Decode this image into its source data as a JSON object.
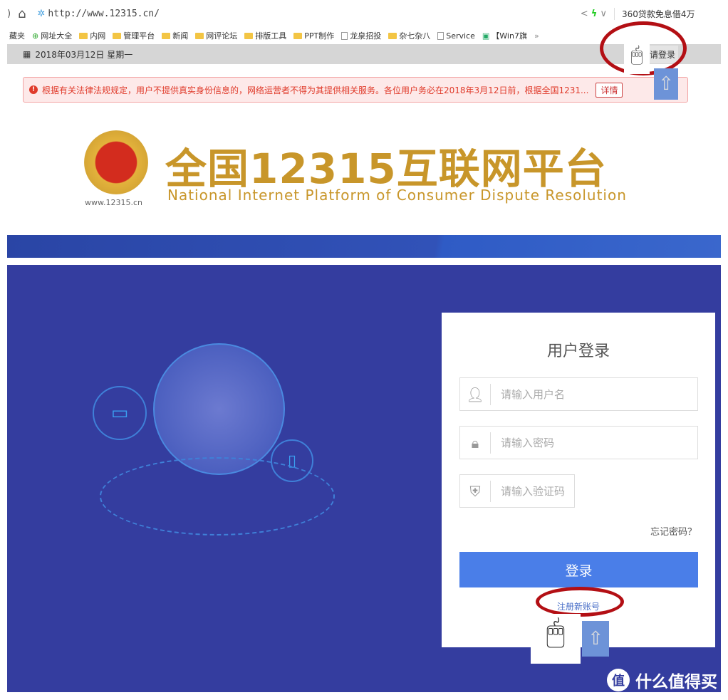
{
  "browser": {
    "url": "http://www.12315.cn/",
    "search_hint": "360贷款免息借4万"
  },
  "bookmarks": [
    {
      "label": "藏夹",
      "icon": "star"
    },
    {
      "label": "网址大全",
      "icon": "globe"
    },
    {
      "label": "内网",
      "icon": "folder"
    },
    {
      "label": "管理平台",
      "icon": "folder"
    },
    {
      "label": "新闻",
      "icon": "folder"
    },
    {
      "label": "网评论坛",
      "icon": "folder"
    },
    {
      "label": "排版工具",
      "icon": "folder"
    },
    {
      "label": "PPT制作",
      "icon": "folder"
    },
    {
      "label": "龙泉招投",
      "icon": "page"
    },
    {
      "label": "杂七杂八",
      "icon": "folder"
    },
    {
      "label": "Service",
      "icon": "page"
    },
    {
      "label": "【Win7旗",
      "icon": "win"
    }
  ],
  "bookmarks_more": "»",
  "topbar": {
    "date": "2018年03月12日 星期一",
    "login_link": "请登录"
  },
  "notice": {
    "text": "根据有关法律法规规定，用户不提供真实身份信息的，网络运营者不得为其提供相关服务。各位用户务必在2018年3月12日前，根据全国1231...",
    "detail_label": "详情"
  },
  "header": {
    "title": "全国12315互联网平台",
    "subtitle": "National Internet Platform of Consumer Dispute Resolution",
    "site": "www.12315.cn"
  },
  "login": {
    "title": "用户登录",
    "username_placeholder": "请输入用户名",
    "password_placeholder": "请输入密码",
    "captcha_placeholder": "请输入验证码",
    "forgot": "忘记密码？",
    "submit": "登录",
    "register": "注册新账号"
  },
  "watermark": {
    "badge": "值",
    "text": "什么值得买"
  },
  "colors": {
    "main_bg": "#343d9f",
    "button": "#4a7ee8",
    "annotation": "#b30f14",
    "title_gold": "#c8962a"
  }
}
